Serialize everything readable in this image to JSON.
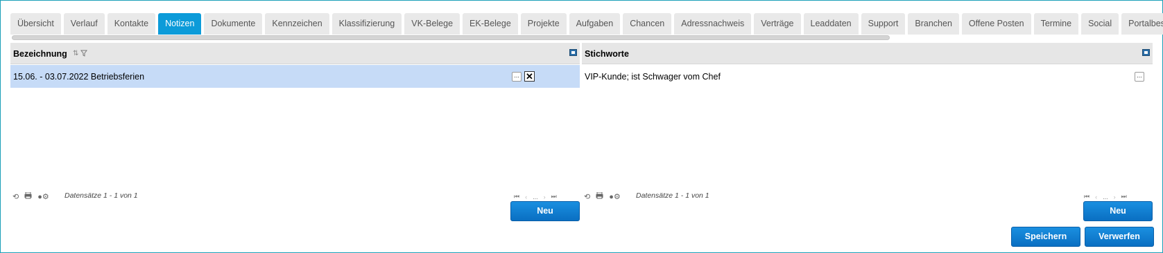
{
  "tabs": [
    {
      "label": "Übersicht",
      "active": false
    },
    {
      "label": "Verlauf",
      "active": false
    },
    {
      "label": "Kontakte",
      "active": false
    },
    {
      "label": "Notizen",
      "active": true
    },
    {
      "label": "Dokumente",
      "active": false
    },
    {
      "label": "Kennzeichen",
      "active": false
    },
    {
      "label": "Klassifizierung",
      "active": false
    },
    {
      "label": "VK-Belege",
      "active": false
    },
    {
      "label": "EK-Belege",
      "active": false
    },
    {
      "label": "Projekte",
      "active": false
    },
    {
      "label": "Aufgaben",
      "active": false
    },
    {
      "label": "Chancen",
      "active": false
    },
    {
      "label": "Adressnachweis",
      "active": false
    },
    {
      "label": "Verträge",
      "active": false
    },
    {
      "label": "Leaddaten",
      "active": false
    },
    {
      "label": "Support",
      "active": false
    },
    {
      "label": "Branchen",
      "active": false
    },
    {
      "label": "Offene Posten",
      "active": false
    },
    {
      "label": "Termine",
      "active": false
    },
    {
      "label": "Social",
      "active": false
    },
    {
      "label": "Portalbesuche",
      "active": false
    }
  ],
  "left_grid": {
    "header": "Bezeichnung",
    "rows": [
      {
        "text": "15.06. - 03.07.2022 Betriebsferien",
        "menu": "...",
        "delete": "✕"
      }
    ],
    "records": "Datensätze 1 - 1 von 1",
    "pager_ellipsis": "...",
    "new_label": "Neu"
  },
  "right_grid": {
    "header": "Stichworte",
    "rows": [
      {
        "text": "VIP-Kunde; ist Schwager vom Chef",
        "menu": "..."
      }
    ],
    "records": "Datensätze 1 - 1 von 1",
    "pager_ellipsis": "...",
    "new_label": "Neu"
  },
  "actions": {
    "save_label": "Speichern",
    "discard_label": "Verwerfen"
  },
  "icons": {
    "sort": "sort-icon",
    "filter": "filter-icon",
    "refresh": "refresh-icon",
    "print": "print-icon",
    "settings": "settings-icon"
  },
  "colors": {
    "accent": "#0c9bd9",
    "selected_row": "#c6dbf7",
    "button": "#0a6fc2"
  }
}
